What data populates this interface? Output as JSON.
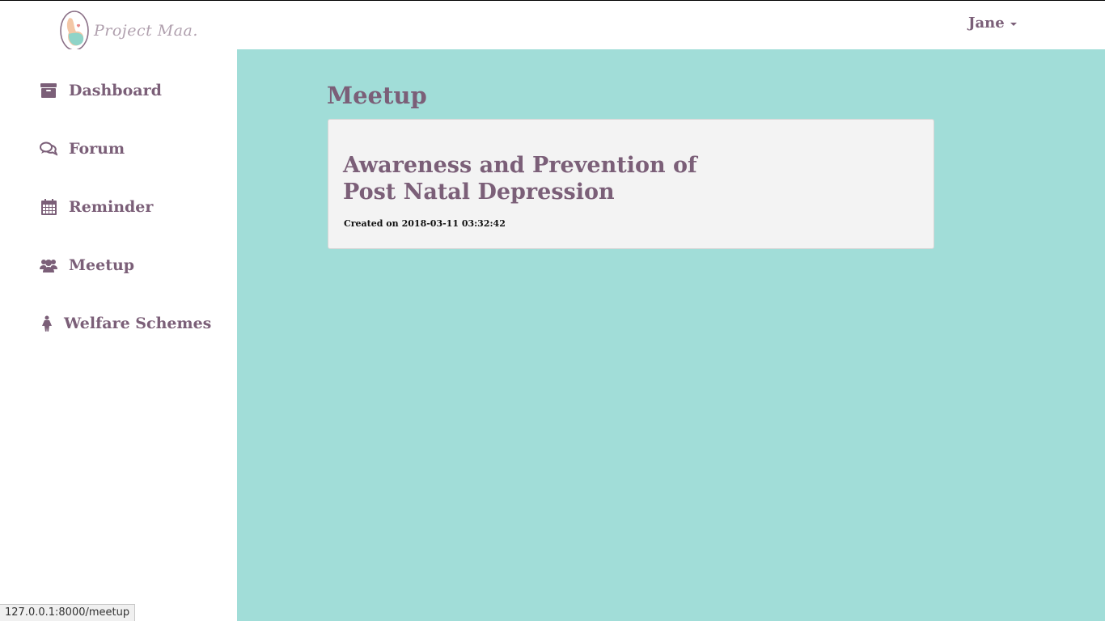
{
  "brand": {
    "name": "Project Maa."
  },
  "user": {
    "name": "Jane"
  },
  "sidebar": {
    "items": [
      {
        "label": "Dashboard",
        "icon": "archive-icon"
      },
      {
        "label": "Forum",
        "icon": "comments-icon"
      },
      {
        "label": "Reminder",
        "icon": "calendar-icon"
      },
      {
        "label": "Meetup",
        "icon": "users-icon"
      },
      {
        "label": "Welfare Schemes",
        "icon": "female-icon"
      }
    ]
  },
  "main": {
    "title": "Meetup",
    "meetups": [
      {
        "title": "Awareness and Prevention of Post Natal Depression",
        "created_label": "Created on",
        "created_at": "2018-03-11 03:32:42"
      }
    ]
  },
  "status_bar": {
    "url": "127.0.0.1:8000/meetup"
  },
  "colors": {
    "accent": "#7b5f78",
    "main_bg": "#a1ddd8",
    "card_bg": "#f3f3f3"
  }
}
